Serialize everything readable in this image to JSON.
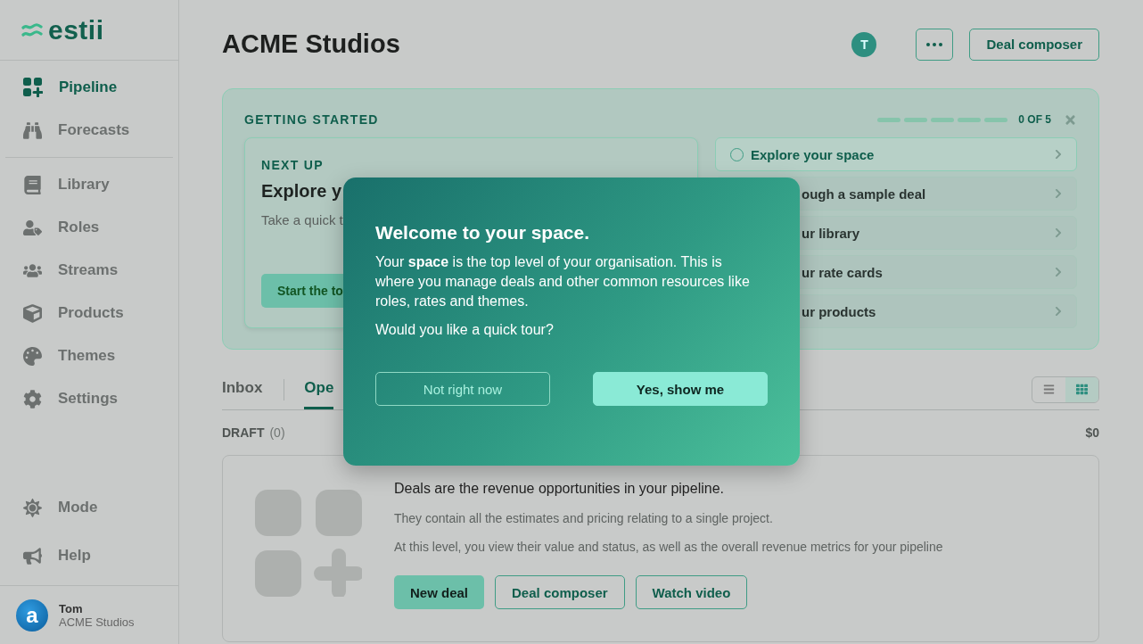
{
  "sidebar": {
    "logo": "estii",
    "nav_groups": [
      [
        {
          "label": "Pipeline",
          "selected": true
        },
        {
          "label": "Forecasts",
          "selected": false
        }
      ],
      [
        {
          "label": "Library",
          "selected": false
        },
        {
          "label": "Roles",
          "selected": false
        },
        {
          "label": "Streams",
          "selected": false
        },
        {
          "label": "Products",
          "selected": false
        },
        {
          "label": "Themes",
          "selected": false
        },
        {
          "label": "Settings",
          "selected": false
        }
      ]
    ],
    "bottom_items": [
      {
        "label": "Mode"
      },
      {
        "label": "Help"
      }
    ],
    "user": {
      "avatar": "a",
      "name": "Tom",
      "org": "ACME Studios"
    }
  },
  "header": {
    "title": "ACME Studios",
    "avatar_initial": "T",
    "composer_button": "Deal composer"
  },
  "getting_started": {
    "title": "GETTING STARTED",
    "progress": {
      "label": "0 OF 5"
    },
    "next_up": {
      "eyebrow": "NEXT UP",
      "title": "Explore y",
      "text": "Take a quick t",
      "button": "Start the to"
    },
    "steps": [
      {
        "label": "Explore your space",
        "selected": true
      },
      {
        "label": "ough a sample deal",
        "selected": false
      },
      {
        "label": "ur library",
        "selected": false
      },
      {
        "label": "ur rate cards",
        "selected": false
      },
      {
        "label": "ur products",
        "selected": false
      }
    ]
  },
  "tabs": [
    {
      "label": "Inbox",
      "selected": false
    },
    {
      "label": "Ope",
      "selected": true
    }
  ],
  "view_toggle": [
    {
      "kind": "list",
      "selected": false
    },
    {
      "kind": "grid",
      "selected": true
    }
  ],
  "section": {
    "title": "DRAFT",
    "count": "(0)",
    "total": "$0"
  },
  "empty_state": {
    "headline": "Deals are the revenue opportunities in your pipeline.",
    "paragraphs": [
      "They contain all the estimates and pricing relating to a single project.",
      "At this level, you view their value and status, as well as the overall revenue metrics for your pipeline"
    ],
    "buttons": [
      {
        "label": "New deal",
        "kind": "primary"
      },
      {
        "label": "Deal composer",
        "kind": "outline"
      },
      {
        "label": "Watch video",
        "kind": "outline"
      }
    ]
  },
  "dialog": {
    "title": "Welcome to your **space**.",
    "paragraphs": [
      "Your **space** is the top level of your organisation. This is where you manage deals and other common resources like roles, rates and themes.",
      "Would you like a quick tour?"
    ],
    "buttons": [
      {
        "label": "Not right now",
        "kind": "secondary"
      },
      {
        "label": "Yes, show me",
        "kind": "primary"
      }
    ]
  }
}
